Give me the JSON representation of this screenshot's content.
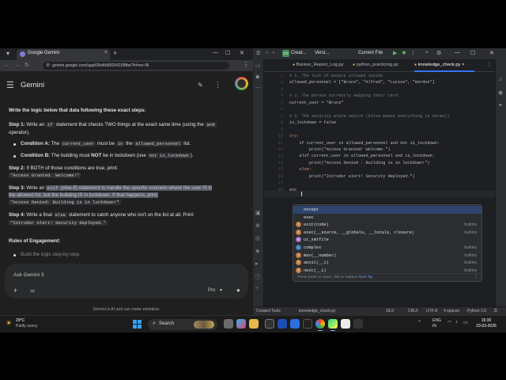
{
  "chrome": {
    "tab_title": "Google Gemini",
    "tab_close": "×",
    "new_tab": "+",
    "url": "gemini.google.com/app/05d4b99254158fbe?hl=en-IN",
    "win_min": "—",
    "win_max": "☐",
    "win_close": "✕"
  },
  "gemini": {
    "brand": "Gemini",
    "input_placeholder": "Ask Gemini 3",
    "mode": "Pro",
    "disclaimer": "Gemini is AI and can make mistakes."
  },
  "chat": {
    "heading": "Write the logic below that data following these exact steps:",
    "step1_a": "Step 1:",
    "step1_b": " Write an ",
    "step1_code": "if",
    "step1_c": " statement that checks TWO things at the exact same time (using the ",
    "step1_code2": "and",
    "step1_d": "operator).",
    "condA_a": "Condition A:",
    "condA_b": " The ",
    "condA_code1": "current_user",
    "condA_c": " must be ",
    "condA_code2": "in",
    "condA_d": " the ",
    "condA_code3": "allowed_personnel",
    "condA_e": " list.",
    "condB_a": "Condition B:",
    "condB_b": " The building must ",
    "condB_not": "NOT",
    "condB_c": " be in lockdown (use ",
    "condB_code": "not is_lockdown",
    "condB_d": ").",
    "step2_a": "Step 2:",
    "step2_b": " If BOTH of those conditions are true, print:",
    "step2_code": "\"Access Granted. Welcome!\"",
    "step3_a": "Step 3:",
    "step3_b": " Write an ",
    "step3_code": "elif",
    "step3_c": " (else-if) statement to handle the specific scenario where the user IS in",
    "step3_d": "the allowed list, but the building IS in lockdown. If that happens, print:",
    "step3_code2": "\"Access Denied: Building is in lockdown!\"",
    "step4_a": "Step 4:",
    "step4_b": " Write a final ",
    "step4_code": "else",
    "step4_c": " statement to catch anyone who isn't on the list at all. Print:",
    "step4_code2": "\"Intruder Alert! Security deployed.\"",
    "rules_heading": "Rules of Engagement:",
    "rule1": "Build the logic step-by-step."
  },
  "ide": {
    "project_badge": "CT",
    "project": "Creat...",
    "vcs": "Versi...",
    "run_config": "Current File",
    "tabs": [
      {
        "label": "Banner_Report_Log.py"
      },
      {
        "label": "python_practicing.py"
      },
      {
        "label": "knowledge_check.py"
      }
    ],
    "tab_close": "×",
    "code": [
      {
        "n": "1",
        "text": "# 1. The list of people allowed inside",
        "cls": "cm"
      },
      {
        "n": "2",
        "text": "allowed_personnel = [\"Bruce\", \"Alfred\", \"Lucius\", \"Gordon\"]",
        "cls": "vr"
      },
      {
        "n": "3",
        "text": "",
        "cls": "vr"
      },
      {
        "n": "4",
        "text": "# 2. The person currently swiping their card",
        "cls": "cm"
      },
      {
        "n": "5",
        "text": "current_user = \"Bruce\"",
        "cls": "vr"
      },
      {
        "n": "6",
        "text": "",
        "cls": "vr"
      },
      {
        "n": "7",
        "text": "# 3. The security alarm switch (False means everything is normal)",
        "cls": "cm"
      },
      {
        "n": "8",
        "text": "is_lockdown = False",
        "cls": "vr"
      },
      {
        "n": "9",
        "text": "",
        "cls": "vr"
      },
      {
        "n": "10",
        "text": "try:",
        "cls": "kw"
      },
      {
        "n": "11",
        "text": "    if current_user in allowed_personnel and not is_lockdown:",
        "cls": "vr"
      },
      {
        "n": "12",
        "text": "        print(\"Access Granted! Welcome.\")",
        "cls": "vr"
      },
      {
        "n": "13",
        "text": "    elif current_user in allowed_personnel and is_lockdown:",
        "cls": "vr"
      },
      {
        "n": "14",
        "text": "        print(\"Access Denied : Building is in lockdown!\")",
        "cls": "vr"
      },
      {
        "n": "15",
        "text": "    else:",
        "cls": "kw"
      },
      {
        "n": "16",
        "text": "        print(\"Intruder alert! Security deployed.\")",
        "cls": "vr"
      },
      {
        "n": "17",
        "text": "",
        "cls": "vr"
      },
      {
        "n": "18",
        "text": "exc",
        "cls": "vr"
      }
    ],
    "completion": [
      {
        "icon": "k",
        "text": "except",
        "src": ""
      },
      {
        "icon": "k",
        "text": "exec",
        "src": ""
      },
      {
        "icon": "f",
        "text": "exit(code)",
        "src": "builtins"
      },
      {
        "icon": "f",
        "text": "exec(__source, __globals, __locals, closure)",
        "src": "builtins"
      },
      {
        "icon": "m",
        "text": "ut_xmlfile",
        "src": ""
      },
      {
        "icon": "c",
        "text": "complex",
        "src": "builtins"
      },
      {
        "icon": "f",
        "text": "max(__number)",
        "src": "builtins"
      },
      {
        "icon": "f",
        "text": "aexit(__i)",
        "src": "builtins"
      },
      {
        "icon": "f",
        "text": "next(__i)",
        "src": "builtins"
      }
    ],
    "hint": "Press Enter to insert, Tab to replace",
    "hint_link": "Next Tip",
    "status": {
      "created": "Created Tools",
      "file": "knowledge_check.py",
      "pos": "18:3",
      "eol": "CRLF",
      "enc": "UTF-8",
      "indent": "4 spaces",
      "python": "Python 3.9"
    }
  },
  "taskbar": {
    "temp": "29°C",
    "weather": "Partly sunny",
    "search": "Search",
    "lang1": "ENG",
    "lang2": "IN",
    "time": "16:30",
    "date": "23-03-2026"
  }
}
